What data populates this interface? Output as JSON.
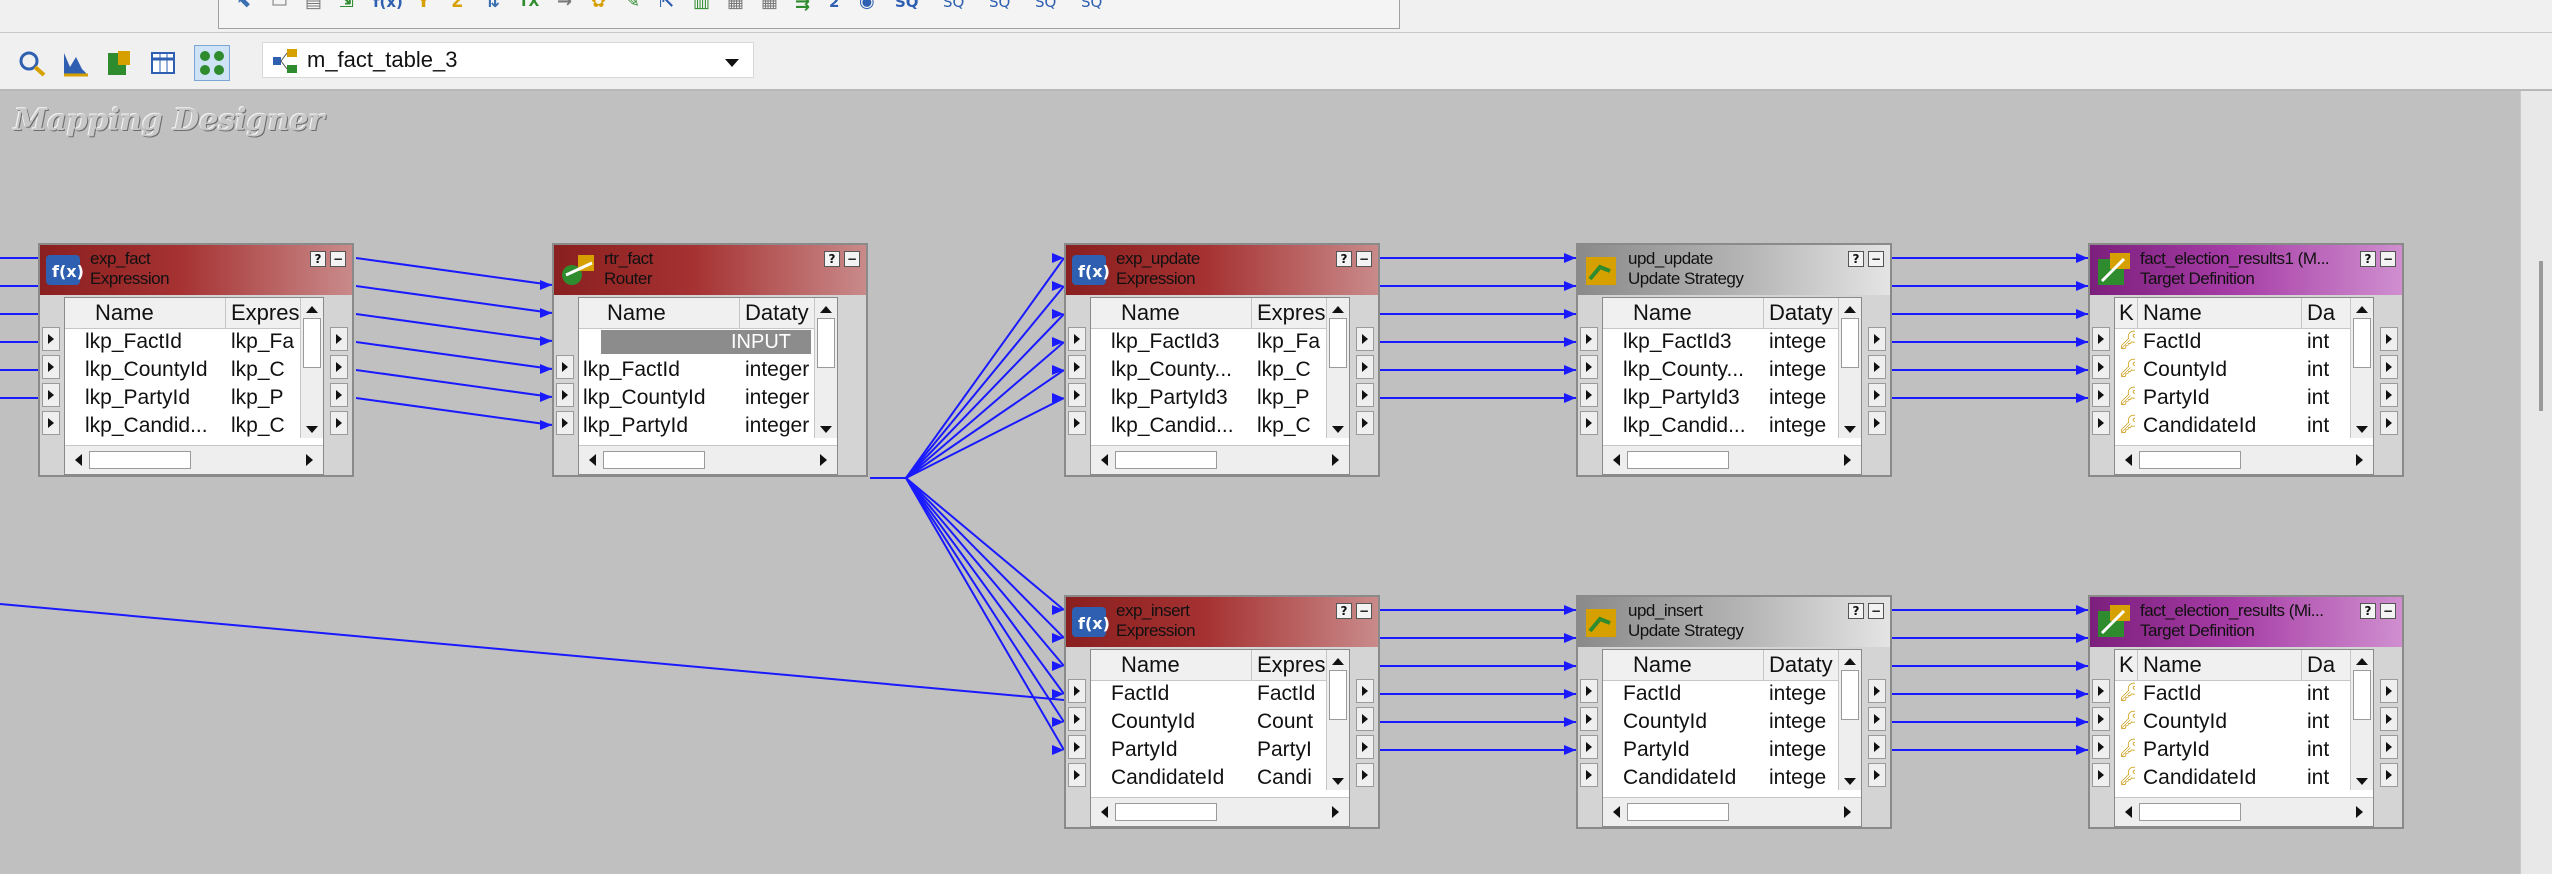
{
  "toolbar_top": {
    "icons": [
      "pointer-icon",
      "select-icon",
      "table-icon",
      "export-icon",
      "function-icon",
      "filter-icon",
      "sigma-icon",
      "sort-icon",
      "tx-icon",
      "arrow-icon",
      "gear-icon",
      "connect-icon",
      "link-icon",
      "bar-icon",
      "grid-icon",
      "stack-icon",
      "sum-icon",
      "refresh-icon",
      "sql-icon",
      "sql-icon-2",
      "sql-icon-3",
      "sql-icon-4",
      "sql-icon-5"
    ],
    "labels": {
      "sq1": "SQ",
      "sq2": "SQ",
      "sq3": "SQ",
      "sq4": "SQ",
      "sq5": "SQ"
    }
  },
  "toolbar2": {
    "mapping_selected": "m_fact_table_3",
    "icons": [
      "find-icon",
      "arrange-icon",
      "edit-icon",
      "table-view-icon",
      "connect-icon"
    ]
  },
  "workspace_title": "Mapping Designer",
  "colors": {
    "link": "#1a1aff",
    "canvas": "#c0c0c0",
    "expression_header": "#a63232",
    "update_header": "#b6b6b6",
    "target_header": "#a63ca6"
  },
  "transformations": [
    {
      "id": "exp_fact",
      "name": "exp_fact",
      "type": "Expression",
      "col1": "Name",
      "col2": "Expres",
      "rows": [
        [
          "lkp_FactId",
          "lkp_Fa"
        ],
        [
          "lkp_CountyId",
          "lkp_C"
        ],
        [
          "lkp_PartyId",
          "lkp_P"
        ],
        [
          "lkp_Candid...",
          "lkp_C"
        ]
      ]
    },
    {
      "id": "rtr_fact",
      "name": "rtr_fact",
      "type": "Router",
      "col1": "Name",
      "col2": "Dataty",
      "group": "INPUT",
      "rows": [
        [
          "lkp_FactId",
          "integer"
        ],
        [
          "lkp_CountyId",
          "integer"
        ],
        [
          "lkp_PartyId",
          "integer"
        ]
      ]
    },
    {
      "id": "exp_update",
      "name": "exp_update",
      "type": "Expression",
      "col1": "Name",
      "col2": "Expres",
      "rows": [
        [
          "lkp_FactId3",
          "lkp_Fa"
        ],
        [
          "lkp_County...",
          "lkp_C"
        ],
        [
          "lkp_PartyId3",
          "lkp_P"
        ],
        [
          "lkp_Candid...",
          "lkp_C"
        ]
      ]
    },
    {
      "id": "upd_update",
      "name": "upd_update",
      "type": "Update Strategy",
      "col1": "Name",
      "col2": "Dataty",
      "rows": [
        [
          "lkp_FactId3",
          "intege"
        ],
        [
          "lkp_County...",
          "intege"
        ],
        [
          "lkp_PartyId3",
          "intege"
        ],
        [
          "lkp_Candid...",
          "intege"
        ]
      ]
    },
    {
      "id": "fact_target1",
      "name": "fact_election_results1 (M...",
      "type": "Target Definition",
      "col0": "K",
      "col1": "Name",
      "col2": "Da",
      "rows": [
        [
          "FactId",
          "int"
        ],
        [
          "CountyId",
          "int"
        ],
        [
          "PartyId",
          "int"
        ],
        [
          "CandidateId",
          "int"
        ]
      ]
    },
    {
      "id": "exp_insert",
      "name": "exp_insert",
      "type": "Expression",
      "col1": "Name",
      "col2": "Expres",
      "rows": [
        [
          "FactId",
          "FactId"
        ],
        [
          "CountyId",
          "Count"
        ],
        [
          "PartyId",
          "PartyI"
        ],
        [
          "CandidateId",
          "Candi"
        ]
      ]
    },
    {
      "id": "upd_insert",
      "name": "upd_insert",
      "type": "Update Strategy",
      "col1": "Name",
      "col2": "Dataty",
      "rows": [
        [
          "FactId",
          "intege"
        ],
        [
          "CountyId",
          "intege"
        ],
        [
          "PartyId",
          "intege"
        ],
        [
          "CandidateId",
          "intege"
        ]
      ]
    },
    {
      "id": "fact_target2",
      "name": "fact_election_results (Mi...",
      "type": "Target Definition",
      "col0": "K",
      "col1": "Name",
      "col2": "Da",
      "rows": [
        [
          "FactId",
          "int"
        ],
        [
          "CountyId",
          "int"
        ],
        [
          "PartyId",
          "int"
        ],
        [
          "CandidateId",
          "int"
        ]
      ]
    }
  ]
}
